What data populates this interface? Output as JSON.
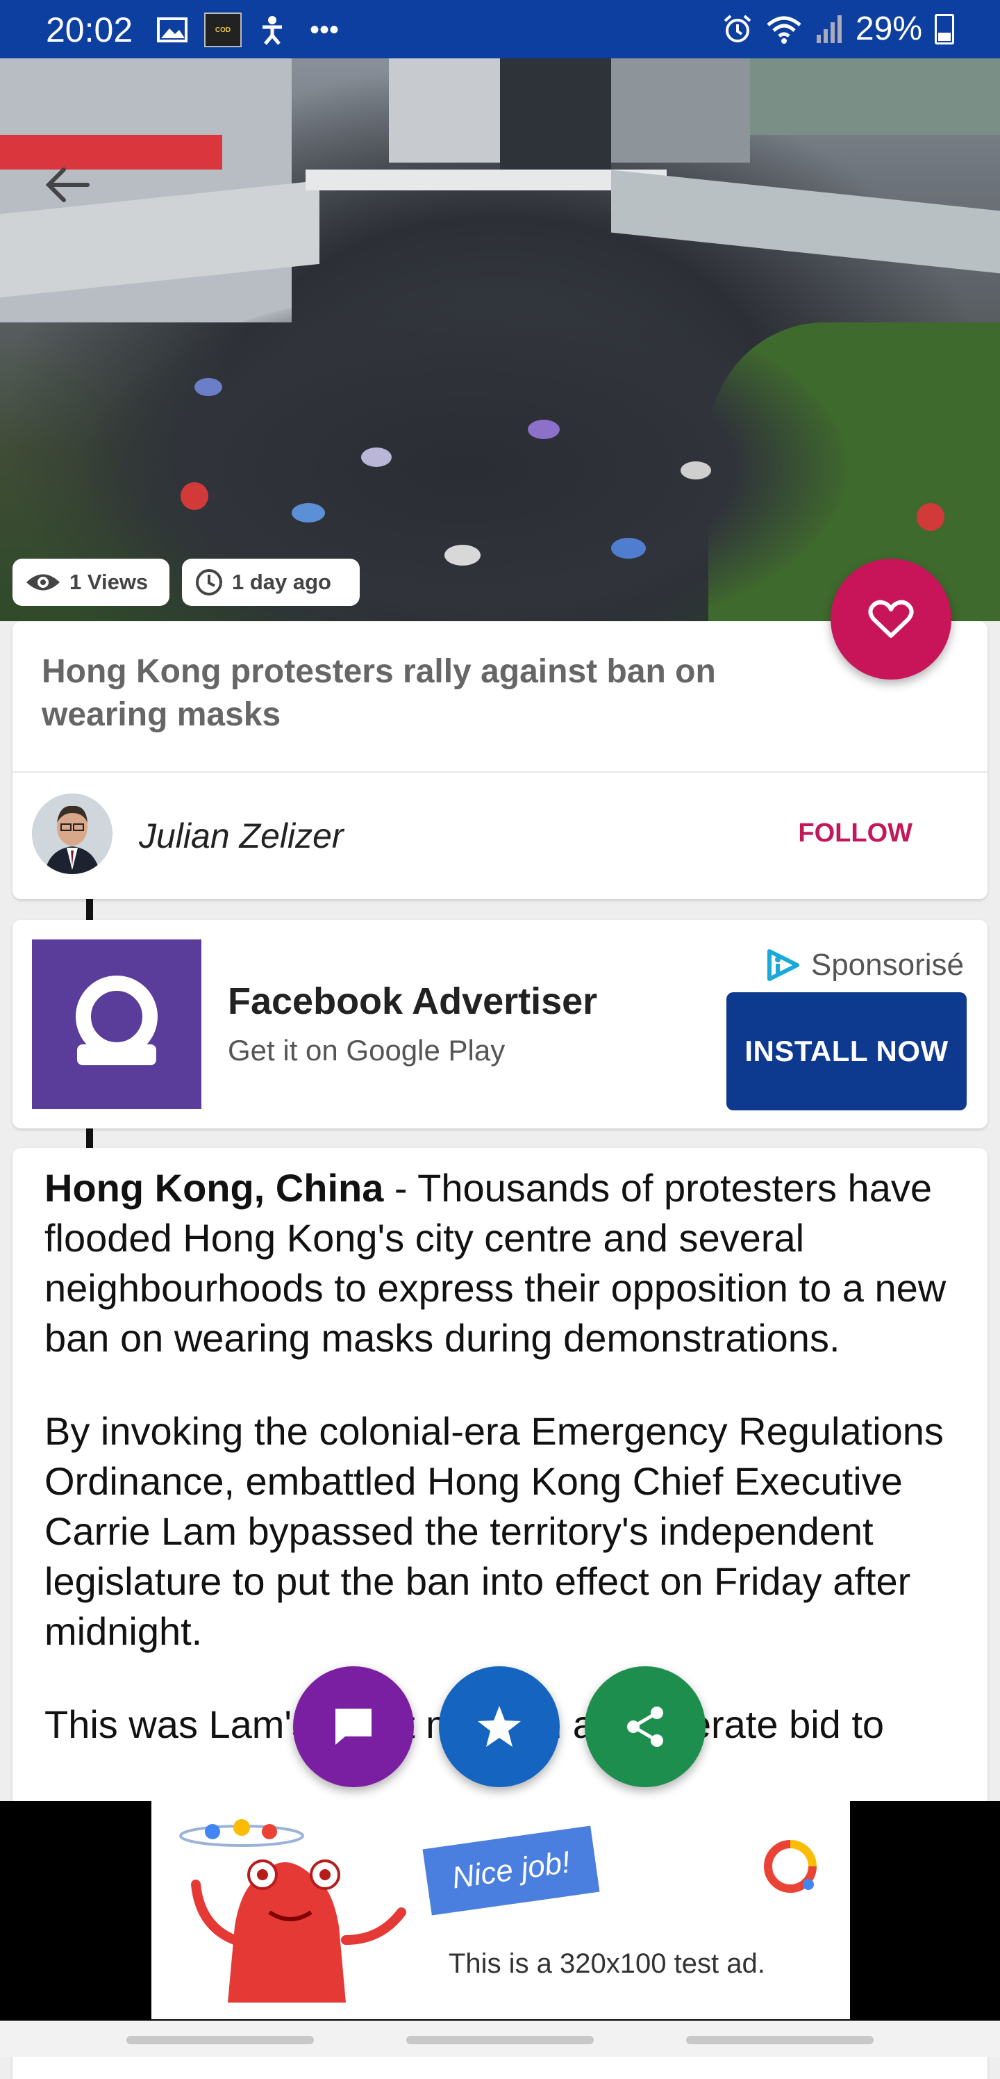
{
  "status_bar": {
    "time": "20:02",
    "battery": "29%",
    "icons": [
      "image-icon",
      "call-of-duty-icon",
      "accessibility-icon",
      "more-icon",
      "alarm-icon",
      "wifi-icon",
      "signal-icon",
      "battery-icon"
    ]
  },
  "hero": {
    "views": "1 Views",
    "time_ago": "1 day ago"
  },
  "article_header": {
    "title": "Hong Kong protesters rally against ban on wearing masks",
    "author": "Julian Zelizer",
    "follow_label": "FOLLOW"
  },
  "ad": {
    "title": "Facebook Advertiser",
    "subtitle": "Get it on Google Play",
    "sponsored": "Sponsorisé",
    "cta": "INSTALL NOW"
  },
  "article": {
    "lead_bold": "Hong Kong, China",
    "p1": " - Thousands of protesters have flooded Hong Kong's city centre and several neighbourhoods to express their opposition to a new ban on wearing masks during demonstrations.",
    "p2": "By invoking the colonial-era Emergency Regulations Ordinance, embattled Hong Kong Chief Executive Carrie Lam bypassed the territory's independent legislature to put the ban into effect on Friday after midnight.",
    "p3": "This was Lam's latest move in a desperate bid to"
  },
  "fabs": [
    "comment-icon",
    "star-icon",
    "share-icon"
  ],
  "banner": {
    "headline": "Nice job!",
    "text": "This is a 320x100 test ad."
  },
  "colors": {
    "status_bar": "#0d3fa0",
    "accent_pink": "#c8155a",
    "install_button": "#0d3a8f",
    "fab_purple": "#7b1fa2",
    "fab_blue": "#1565c0",
    "fab_green": "#1e8e4e"
  }
}
